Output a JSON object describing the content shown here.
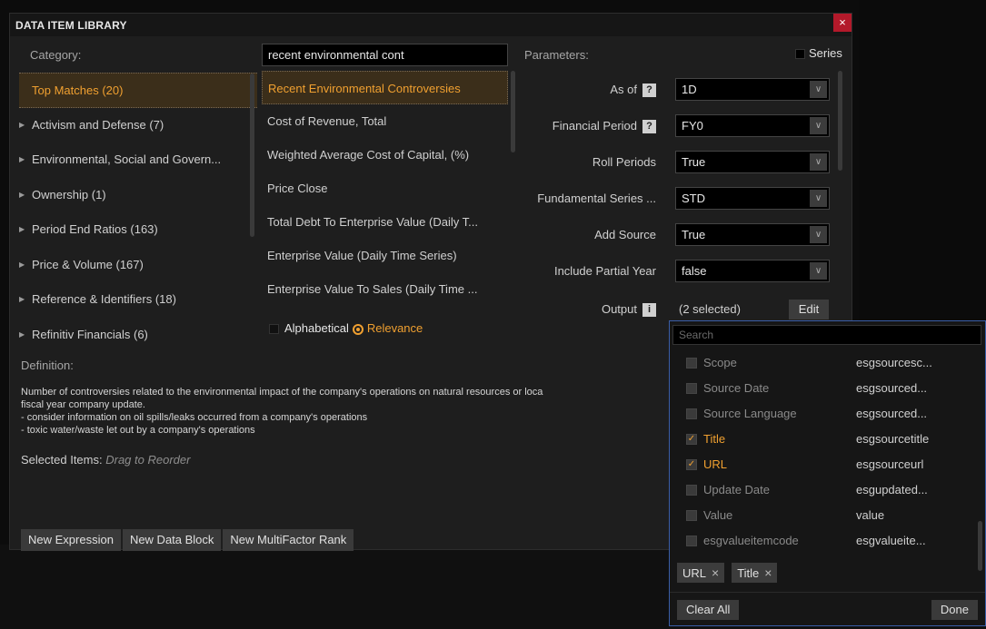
{
  "title": "DATA ITEM LIBRARY",
  "close_glyph": "×",
  "category": {
    "header": "Category:",
    "items": [
      {
        "label": "Top Matches (20)"
      },
      {
        "label": "Activism and Defense (7)"
      },
      {
        "label": "Environmental, Social and Govern..."
      },
      {
        "label": "Ownership (1)"
      },
      {
        "label": "Period End Ratios (163)"
      },
      {
        "label": "Price & Volume (167)"
      },
      {
        "label": "Reference & Identifiers (18)"
      },
      {
        "label": "Refinitiv Financials (6)"
      }
    ]
  },
  "search": {
    "value": "recent environmental cont"
  },
  "items": [
    {
      "label": "Recent Environmental Controversies"
    },
    {
      "label": "Cost of Revenue, Total"
    },
    {
      "label": "Weighted Average Cost of Capital, (%)"
    },
    {
      "label": "Price Close"
    },
    {
      "label": "Total Debt To Enterprise Value (Daily T..."
    },
    {
      "label": "Enterprise Value (Daily Time Series)"
    },
    {
      "label": "Enterprise Value To Sales (Daily Time ..."
    }
  ],
  "sort": {
    "alphabetical": "Alphabetical",
    "relevance": "Relevance"
  },
  "parameters": {
    "header": "Parameters:",
    "series_label": "Series",
    "rows": [
      {
        "label": "As of",
        "value": "1D"
      },
      {
        "label": "Financial Period",
        "value": "FY0"
      },
      {
        "label": "Roll Periods",
        "value": "True"
      },
      {
        "label": "Fundamental Series ...",
        "value": "STD"
      },
      {
        "label": "Add Source",
        "value": "True"
      },
      {
        "label": "Include Partial Year",
        "value": "false"
      }
    ],
    "output_label": "Output",
    "output_value": "(2 selected)",
    "edit_label": "Edit",
    "help_glyph": "?",
    "info_glyph": "i",
    "caret_glyph": "∨"
  },
  "definition": {
    "header": "Definition:",
    "lines": [
      "Number of controversies related to the environmental impact of the company's operations on natural resources or loca",
      "fiscal year company update.",
      "- consider information on oil spills/leaks occurred from a company's operations",
      "- toxic water/waste let out by a company's operations"
    ]
  },
  "selected_items": {
    "label": "Selected Items:",
    "hint": "Drag to Reorder"
  },
  "bottom_buttons": [
    "New Expression",
    "New Data Block",
    "New MultiFactor Rank"
  ],
  "output_popup": {
    "search_placeholder": "Search",
    "rows": [
      {
        "name": "Scope",
        "code": "esgsourcesc...",
        "checked": false
      },
      {
        "name": "Source Date",
        "code": "esgsourced...",
        "checked": false
      },
      {
        "name": "Source Language",
        "code": "esgsourced...",
        "checked": false
      },
      {
        "name": "Title",
        "code": "esgsourcetitle",
        "checked": true
      },
      {
        "name": "URL",
        "code": "esgsourceurl",
        "checked": true
      },
      {
        "name": "Update Date",
        "code": "esgupdated...",
        "checked": false
      },
      {
        "name": "Value",
        "code": "value",
        "checked": false
      },
      {
        "name": "esgvalueitemcode",
        "code": "esgvalueite...",
        "checked": false
      }
    ],
    "chips": [
      "URL",
      "Title"
    ],
    "chip_remove_glyph": "×",
    "check_glyph": "✓",
    "clear_label": "Clear All",
    "done_label": "Done"
  },
  "colors": {
    "accent": "#f0a030",
    "close": "#b3192a",
    "popup_border": "#3a5ea8"
  }
}
